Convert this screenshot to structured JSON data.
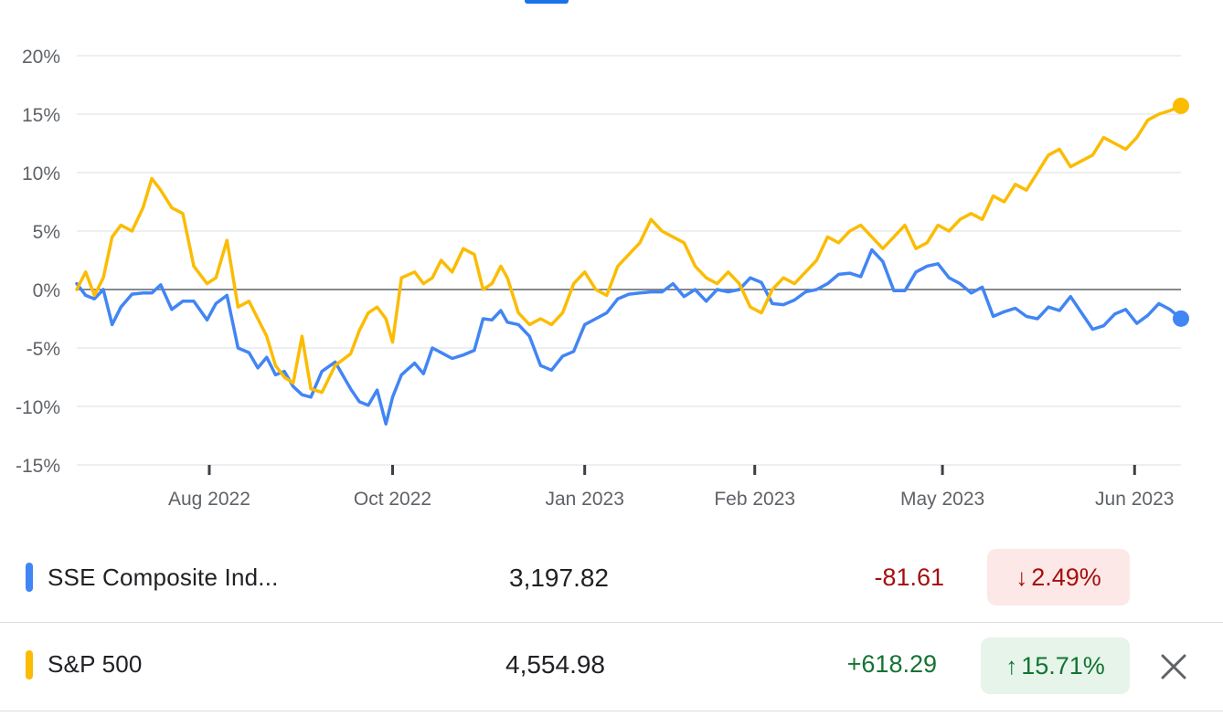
{
  "colors": {
    "sse": "#4285f4",
    "sp500": "#fbbc04",
    "negative_text": "#a50e0e",
    "negative_bg": "#fce8e6",
    "positive_text": "#137333",
    "positive_bg": "#e6f4ea",
    "grid": "#e8eaed",
    "zero_line": "#5f6368",
    "axis_text": "#5f6368"
  },
  "chart_data": {
    "type": "line",
    "title": "",
    "xlabel": "",
    "ylabel": "",
    "ylim": [
      -15,
      20
    ],
    "yticks": [
      20,
      15,
      10,
      5,
      0,
      -5,
      -10,
      -15
    ],
    "ytick_labels": [
      "20%",
      "15%",
      "10%",
      "5%",
      "0%",
      "-5%",
      "-10%",
      "-15%"
    ],
    "x_range": [
      0,
      100
    ],
    "xticks": [
      {
        "pos": 12.0,
        "label": "Aug 2022"
      },
      {
        "pos": 28.6,
        "label": "Oct 2022"
      },
      {
        "pos": 46.0,
        "label": "Jan 2023"
      },
      {
        "pos": 61.4,
        "label": "Feb 2023"
      },
      {
        "pos": 78.4,
        "label": "May 2023"
      },
      {
        "pos": 95.8,
        "label": "Jun 2023"
      }
    ],
    "grid": true,
    "baseline": 0,
    "series": [
      {
        "name": "SSE Composite Ind...",
        "color_key": "sse",
        "x": [
          0,
          0.8,
          1.6,
          2.4,
          3.2,
          4.0,
          5.0,
          6.0,
          6.8,
          7.6,
          8.6,
          9.6,
          10.6,
          11.8,
          12.6,
          13.6,
          14.6,
          15.6,
          16.4,
          17.2,
          18.0,
          18.8,
          19.6,
          20.4,
          21.2,
          22.2,
          23.4,
          24.8,
          25.6,
          26.4,
          27.2,
          28.0,
          28.6,
          29.4,
          30.6,
          31.4,
          32.2,
          33.0,
          34.0,
          35.0,
          36.0,
          36.8,
          37.6,
          38.4,
          39.0,
          40.0,
          41.0,
          42.0,
          43.0,
          44.0,
          45.0,
          46.0,
          47.0,
          48.0,
          49.0,
          50.0,
          51.0,
          52.0,
          53.0,
          54.0,
          55.0,
          56.0,
          57.0,
          58.0,
          59.0,
          60.0,
          61.0,
          62.0,
          63.0,
          64.0,
          65.0,
          66.0,
          67.0,
          68.0,
          69.0,
          70.0,
          71.0,
          72.0,
          73.0,
          74.0,
          75.0,
          76.0,
          77.0,
          78.0,
          79.0,
          80.0,
          81.0,
          82.0,
          83.0,
          84.0,
          85.0,
          86.0,
          87.0,
          88.0,
          89.0,
          90.0,
          91.0,
          92.0,
          93.0,
          94.0,
          95.0,
          96.0,
          97.0,
          98.0,
          99.0,
          100.0
        ],
        "values": [
          0.5,
          -0.5,
          -0.8,
          0.0,
          -3.0,
          -1.5,
          -0.4,
          -0.3,
          -0.3,
          0.4,
          -1.7,
          -1.0,
          -1.0,
          -2.6,
          -1.2,
          -0.5,
          -5.0,
          -5.4,
          -6.7,
          -5.8,
          -7.3,
          -7.0,
          -8.3,
          -9.0,
          -9.2,
          -7.0,
          -6.2,
          -8.5,
          -9.6,
          -9.9,
          -8.6,
          -11.5,
          -9.2,
          -7.3,
          -6.3,
          -7.2,
          -5.0,
          -5.4,
          -5.9,
          -5.6,
          -5.2,
          -2.5,
          -2.6,
          -1.8,
          -2.8,
          -3.0,
          -4.0,
          -6.5,
          -6.9,
          -5.7,
          -5.3,
          -3.0,
          -2.5,
          -2.0,
          -0.8,
          -0.4,
          -0.3,
          -0.2,
          -0.2,
          0.5,
          -0.6,
          0.0,
          -1.0,
          0.0,
          -0.2,
          0.0,
          1.0,
          0.6,
          -1.2,
          -1.3,
          -0.9,
          -0.2,
          0.0,
          0.5,
          1.3,
          1.4,
          1.1,
          3.4,
          2.4,
          -0.1,
          -0.1,
          1.5,
          2.0,
          2.2,
          1.0,
          0.5,
          -0.3,
          0.2,
          -2.3,
          -1.9,
          -1.6,
          -2.3,
          -2.5,
          -1.5,
          -1.8,
          -0.6,
          -2.0,
          -3.4,
          -3.1,
          -2.1,
          -1.7,
          -2.9,
          -2.2,
          -1.2,
          -1.7,
          -2.49
        ]
      },
      {
        "name": "S&P 500",
        "color_key": "sp500",
        "x": [
          0,
          0.8,
          1.6,
          2.4,
          3.2,
          4.0,
          5.0,
          6.0,
          6.8,
          7.6,
          8.6,
          9.6,
          10.6,
          11.8,
          12.6,
          13.6,
          14.6,
          15.6,
          16.4,
          17.2,
          18.0,
          18.8,
          19.6,
          20.4,
          21.2,
          22.2,
          23.4,
          24.8,
          25.6,
          26.4,
          27.2,
          28.0,
          28.6,
          29.4,
          30.6,
          31.4,
          32.2,
          33.0,
          34.0,
          35.0,
          36.0,
          36.8,
          37.6,
          38.4,
          39.0,
          40.0,
          41.0,
          42.0,
          43.0,
          44.0,
          45.0,
          46.0,
          47.0,
          48.0,
          49.0,
          50.0,
          51.0,
          52.0,
          53.0,
          54.0,
          55.0,
          56.0,
          57.0,
          58.0,
          59.0,
          60.0,
          61.0,
          62.0,
          63.0,
          64.0,
          65.0,
          66.0,
          67.0,
          68.0,
          69.0,
          70.0,
          71.0,
          72.0,
          73.0,
          74.0,
          75.0,
          76.0,
          77.0,
          78.0,
          79.0,
          80.0,
          81.0,
          82.0,
          83.0,
          84.0,
          85.0,
          86.0,
          87.0,
          88.0,
          89.0,
          90.0,
          91.0,
          92.0,
          93.0,
          94.0,
          95.0,
          96.0,
          97.0,
          98.0,
          99.0,
          100.0
        ],
        "values": [
          0.0,
          1.5,
          -0.5,
          1.0,
          4.5,
          5.5,
          5.0,
          7.0,
          9.5,
          8.5,
          7.0,
          6.5,
          2.0,
          0.5,
          1.0,
          4.2,
          -1.5,
          -1.0,
          -2.5,
          -4.0,
          -6.5,
          -7.5,
          -8.0,
          -4.0,
          -8.5,
          -8.8,
          -6.5,
          -5.5,
          -3.5,
          -2.0,
          -1.5,
          -2.5,
          -4.5,
          1.0,
          1.5,
          0.5,
          1.0,
          2.5,
          1.5,
          3.5,
          3.0,
          0.0,
          0.5,
          2.0,
          1.0,
          -2.0,
          -3.0,
          -2.5,
          -3.0,
          -2.0,
          0.5,
          1.5,
          0.0,
          -0.5,
          2.0,
          3.0,
          4.0,
          6.0,
          5.0,
          4.5,
          4.0,
          2.0,
          1.0,
          0.5,
          1.5,
          0.5,
          -1.5,
          -2.0,
          0.0,
          1.0,
          0.5,
          1.5,
          2.5,
          4.5,
          4.0,
          5.0,
          5.5,
          4.5,
          3.5,
          4.5,
          5.5,
          3.5,
          4.0,
          5.5,
          5.0,
          6.0,
          6.5,
          6.0,
          8.0,
          7.5,
          9.0,
          8.5,
          10.0,
          11.5,
          12.0,
          10.5,
          11.0,
          11.5,
          13.0,
          12.5,
          12.0,
          13.0,
          14.5,
          15.0,
          15.3,
          15.71
        ]
      }
    ]
  },
  "rows": [
    {
      "name": "SSE Composite Ind...",
      "price": "3,197.82",
      "change": "-81.61",
      "percent": "2.49%",
      "direction": "down",
      "arrow_icon": "arrow-down-icon"
    },
    {
      "name": "S&P 500",
      "price": "4,554.98",
      "change": "+618.29",
      "percent": "15.71%",
      "direction": "up",
      "arrow_icon": "arrow-up-icon",
      "close_icon": "close-icon"
    }
  ]
}
